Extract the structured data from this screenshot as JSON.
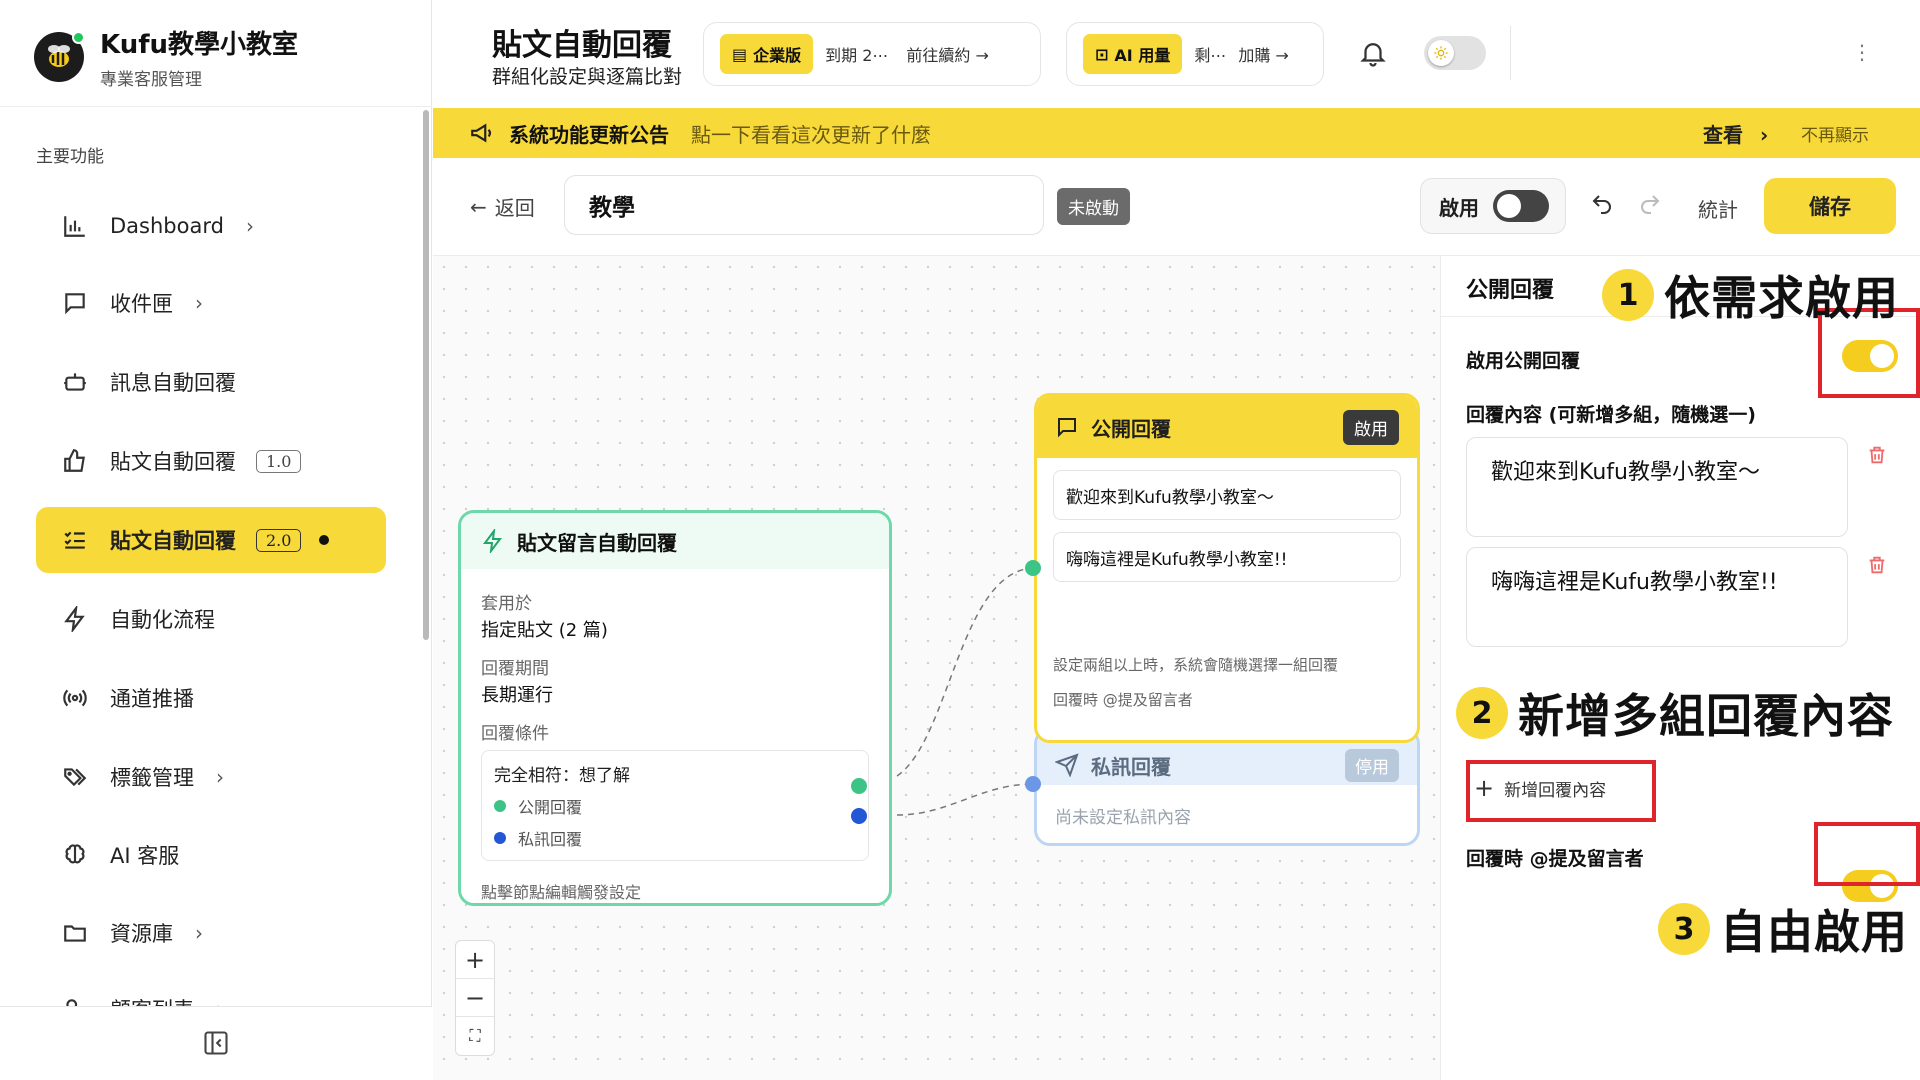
{
  "app": {
    "name": "Kufu教學小教室",
    "subtitle": "專業客服管理"
  },
  "sidebar": {
    "section_label": "主要功能",
    "items": [
      {
        "label": "Dashboard",
        "icon": "bar-chart-icon",
        "has_chevron": true
      },
      {
        "label": "收件匣",
        "icon": "message-square-icon",
        "has_chevron": true
      },
      {
        "label": "訊息自動回覆",
        "icon": "bot-icon",
        "has_chevron": false
      },
      {
        "label": "貼文自動回覆",
        "icon": "thumbs-up-icon",
        "badge": "1.0"
      },
      {
        "label": "貼文自動回覆",
        "icon": "list-check-icon",
        "badge": "2.0",
        "active": true
      },
      {
        "label": "自動化流程",
        "icon": "zap-icon",
        "has_chevron": false
      },
      {
        "label": "通道推播",
        "icon": "broadcast-icon",
        "has_chevron": false
      },
      {
        "label": "標籤管理",
        "icon": "tags-icon",
        "has_chevron": true
      },
      {
        "label": "AI 客服",
        "icon": "brain-icon",
        "has_chevron": false
      },
      {
        "label": "資源庫",
        "icon": "folder-icon",
        "has_chevron": true
      },
      {
        "label": "顧客列表",
        "icon": "users-icon",
        "has_chevron": true
      }
    ]
  },
  "header": {
    "title": "貼文自動回覆",
    "subtitle": "群組化設定與逐篇比對",
    "plan": {
      "tag": "企業版",
      "expiry": "到期 2⋯",
      "action": "前往續約 →"
    },
    "ai_usage": {
      "tag": "AI 用量",
      "remaining": "剩⋯",
      "action": "加購 →"
    }
  },
  "banner": {
    "title": "系統功能更新公告",
    "desc": "點一下看看這次更新了什麼",
    "view": "查看",
    "dismiss": "不再顯示"
  },
  "toolbar": {
    "back": "返回",
    "name_value": "教學",
    "status": "未啟動",
    "enable_label": "啟用",
    "stats": "統計",
    "save": "儲存"
  },
  "trigger_node": {
    "title": "貼文留言自動回覆",
    "apply_label": "套用於",
    "apply_value": "指定貼文 (2 篇)",
    "period_label": "回覆期間",
    "period_value": "長期運行",
    "cond_label": "回覆條件",
    "cond_value": "完全相符：想了解",
    "out_public": "公開回覆",
    "out_private": "私訊回覆",
    "footer": "點擊節點編輯觸發設定"
  },
  "public_node": {
    "title": "公開回覆",
    "badge": "啟用",
    "messages": [
      "歡迎來到Kufu教學小教室～",
      "嗨嗨這裡是Kufu教學小教室!!"
    ],
    "note1": "設定兩組以上時，系統會隨機選擇一組回覆",
    "note2": "回覆時 @提及留言者"
  },
  "private_node": {
    "title": "私訊回覆",
    "badge": "停用",
    "body": "尚未設定私訊內容"
  },
  "zoom": {
    "in": "+",
    "out": "−",
    "fit": "⛶"
  },
  "panel": {
    "title": "公開回覆",
    "enable_label": "啟用公開回覆",
    "content_label": "回覆內容 (可新增多組，隨機選一)",
    "replies": [
      "歡迎來到Kufu教學小教室～",
      "嗨嗨這裡是Kufu教學小教室!!"
    ],
    "add_label": "新增回覆內容",
    "mention_label": "回覆時 @提及留言者"
  },
  "annotations": [
    {
      "num": "1",
      "text": "依需求啟用"
    },
    {
      "num": "2",
      "text": "新增多組回覆內容"
    },
    {
      "num": "3",
      "text": "自由啟用"
    }
  ],
  "colors": {
    "accent": "#f8d93a",
    "trigger_border": "#6fd8aa",
    "private_border": "#bcd6f4",
    "highlight": "#e0242c"
  }
}
